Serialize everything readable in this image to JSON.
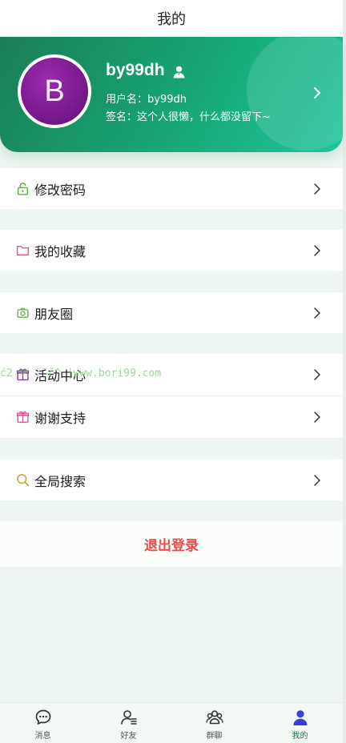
{
  "header": {
    "title": "我的"
  },
  "profile": {
    "avatar_letter": "B",
    "nickname": "by99dh",
    "username": "用户名：by99dh",
    "signature": "签名：这个人很懒，什么都没留下~"
  },
  "menu": [
    {
      "label": "修改密码",
      "icon": "lock-icon",
      "icon_color": "#5fae4f"
    },
    {
      "label": "我的收藏",
      "icon": "folder-icon",
      "icon_color": "#d9569a"
    },
    {
      "label": "朋友圈",
      "icon": "camera-icon",
      "icon_color": "#6cae5c"
    },
    {
      "label": "活动中心",
      "icon": "gift-icon",
      "icon_color": "#7a3d8e"
    },
    {
      "label": "谢谢支持",
      "icon": "gift-icon",
      "icon_color": "#d9569a"
    },
    {
      "label": "全局搜索",
      "icon": "search-icon",
      "icon_color": "#c9a24a"
    }
  ],
  "watermark": "ć2 🙨 ̈ ̃ č^ |www.bori99.com",
  "logout_label": "退出登录",
  "tabs": [
    {
      "label": "消息",
      "icon": "chat-icon"
    },
    {
      "label": "好友",
      "icon": "friends-icon"
    },
    {
      "label": "群聊",
      "icon": "group-icon"
    },
    {
      "label": "我的",
      "icon": "user-icon",
      "active": true
    }
  ],
  "colors": {
    "brand_green": "#17a775",
    "logout_red": "#ea4b4b",
    "active_tab": "#3b3fd8"
  }
}
